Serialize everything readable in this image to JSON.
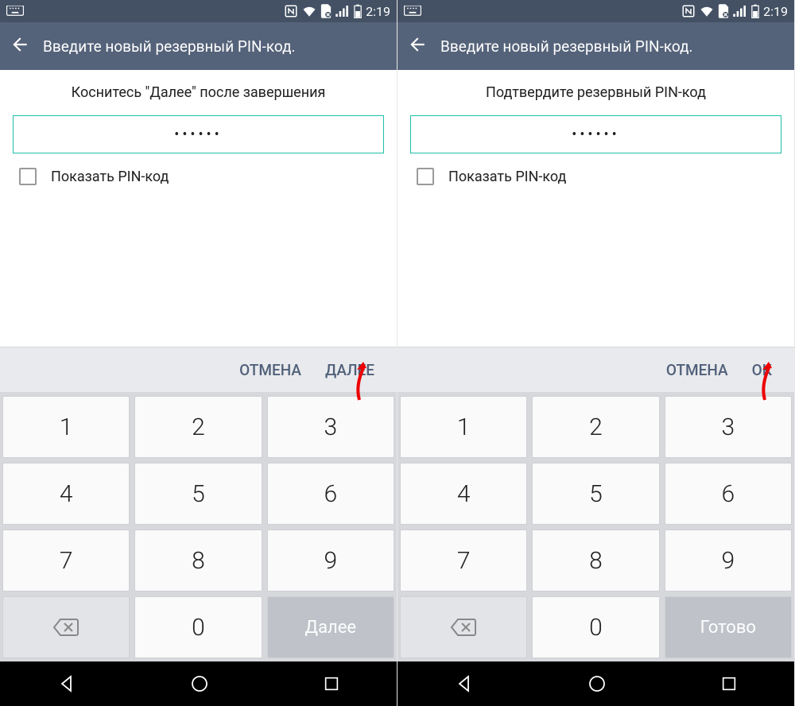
{
  "status": {
    "time": "2:19",
    "icons": [
      "nfc",
      "wifi",
      "sim",
      "signal",
      "battery"
    ]
  },
  "screens": [
    {
      "title": "Введите новый резервный PIN-код.",
      "instruction": "Коснитесь \"Далее\" после завершения",
      "pin_mask": "••••••",
      "show_pin_label": "Показать PIN-код",
      "actions": {
        "cancel": "ОТМЕНА",
        "confirm": "ДАЛЕЕ"
      },
      "keypad_action": "Далее"
    },
    {
      "title": "Введите новый резервный PIN-код.",
      "instruction": "Подтвердите резервный PIN-код",
      "pin_mask": "••••••",
      "show_pin_label": "Показать PIN-код",
      "actions": {
        "cancel": "ОТМЕНА",
        "confirm": "ОК"
      },
      "keypad_action": "Готово"
    }
  ],
  "keypad_digits": [
    "1",
    "2",
    "3",
    "4",
    "5",
    "6",
    "7",
    "8",
    "9",
    "",
    "0",
    ""
  ]
}
